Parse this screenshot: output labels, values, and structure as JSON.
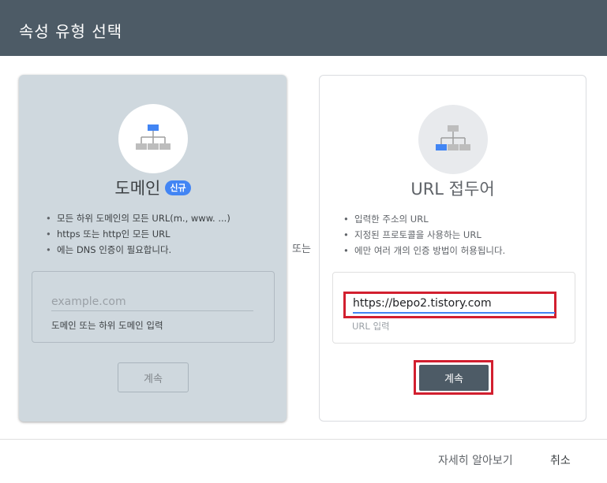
{
  "dialog": {
    "title": "속성 유형 선택"
  },
  "domain_card": {
    "title": "도메인",
    "badge": "신규",
    "bullets": [
      "모든 하위 도메인의 모든 URL(m., www. ...)",
      "https 또는 http인 모든 URL",
      "에는 DNS 인증이 필요합니다."
    ],
    "input_placeholder": "example.com",
    "input_value": "",
    "helper": "도메인 또는 하위 도메인 입력",
    "continue_label": "계속"
  },
  "or_label": "또는",
  "url_card": {
    "title": "URL 접두어",
    "bullets": [
      "입력한 주소의 URL",
      "지정된 프로토콜을 사용하는 URL",
      "에만 여러 개의 인증 방법이 허용됩니다."
    ],
    "input_value": "https://bepo2.tistory.com",
    "helper": "URL 입력",
    "continue_label": "계속"
  },
  "footer": {
    "learn_more": "자세히 알아보기",
    "cancel": "취소"
  },
  "colors": {
    "header": "#4d5b66",
    "domain_card_bg": "#cfd8de",
    "accent": "#4285f4",
    "highlight": "#d21f2f"
  }
}
